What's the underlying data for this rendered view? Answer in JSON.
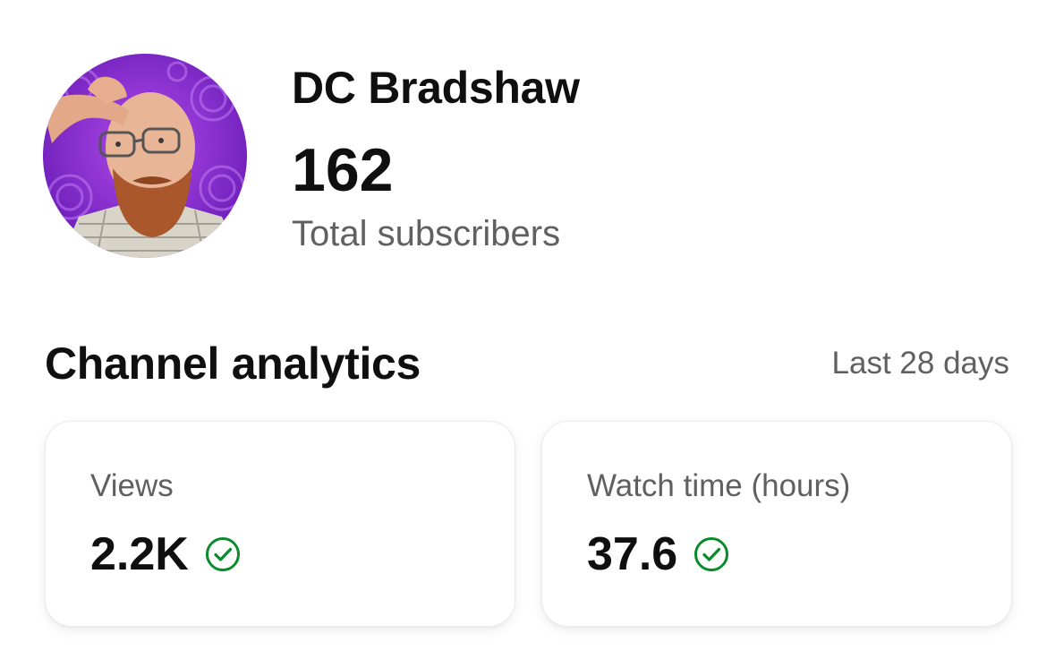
{
  "channel": {
    "name": "DC Bradshaw",
    "subscriber_count": "162",
    "subscriber_label": "Total subscribers",
    "avatar_icon": "channel-avatar"
  },
  "analytics": {
    "title": "Channel analytics",
    "range": "Last 28 days",
    "cards": [
      {
        "label": "Views",
        "value": "2.2K",
        "status_icon": "check-circle-icon"
      },
      {
        "label": "Watch time (hours)",
        "value": "37.6",
        "status_icon": "check-circle-icon"
      }
    ]
  },
  "colors": {
    "accent_purple": "#8a2be2",
    "check_green": "#0a8a2a",
    "secondary_text": "#606060"
  }
}
